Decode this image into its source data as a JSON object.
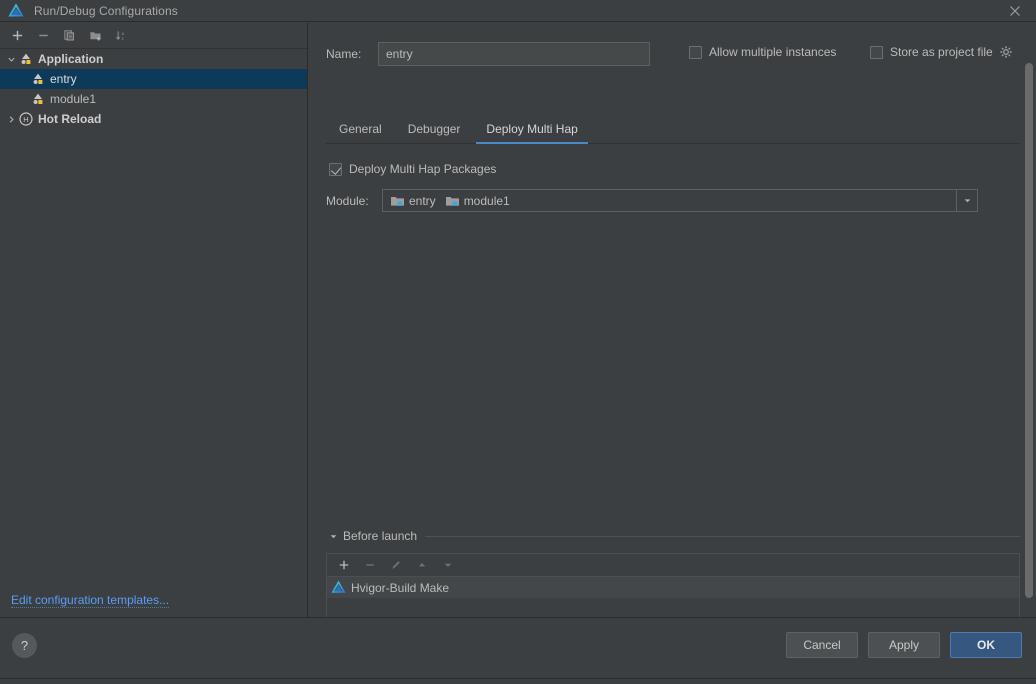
{
  "window": {
    "title": "Run/Debug Configurations",
    "logo_icon": "deveco-studio-logo-icon",
    "close_icon": "close-icon"
  },
  "colors": {
    "background": "#3c3f41",
    "panel_border": "#2b2b2b",
    "text": "#bbbbbb",
    "accent_blue": "#4a88c7",
    "selection": "#0d3a58",
    "link": "#589df6",
    "primary_button": "#365880"
  },
  "sidebar": {
    "toolbar": [
      {
        "name": "add-configuration-button",
        "icon": "plus-icon",
        "label": "+",
        "enabled": true
      },
      {
        "name": "remove-configuration-button",
        "icon": "minus-icon",
        "label": "−",
        "enabled": false
      },
      {
        "name": "copy-configuration-button",
        "icon": "copy-icon",
        "label": "",
        "enabled": false
      },
      {
        "name": "move-into-folder-button",
        "icon": "folder-add-icon",
        "label": "",
        "enabled": false
      },
      {
        "name": "sort-configurations-button",
        "icon": "sort-alphabetically-icon",
        "label": "",
        "enabled": false
      }
    ],
    "tree": [
      {
        "label": "Application",
        "icon": "application-module-icon",
        "expanded": true,
        "level": 0,
        "bold": true,
        "selected": false,
        "has_arrow": true
      },
      {
        "label": "entry",
        "icon": "application-module-icon",
        "level": 1,
        "bold": false,
        "selected": true,
        "has_arrow": false
      },
      {
        "label": "module1",
        "icon": "application-module-icon",
        "level": 1,
        "bold": false,
        "selected": false,
        "has_arrow": false
      },
      {
        "label": "Hot Reload",
        "icon": "hot-reload-icon",
        "expanded": false,
        "level": 0,
        "bold": true,
        "selected": false,
        "has_arrow": true
      }
    ],
    "edit_templates_link": "Edit configuration templates..."
  },
  "main": {
    "name_field": {
      "label": "Name:",
      "value": "entry",
      "placeholder": ""
    },
    "options": [
      {
        "label": "Allow multiple instances",
        "checked": false,
        "name": "allow-multiple-instances-checkbox"
      },
      {
        "label": "Store as project file",
        "checked": false,
        "name": "store-as-project-file-checkbox",
        "gear_icon": "gear-icon"
      }
    ],
    "tabs": [
      {
        "label": "General",
        "active": false
      },
      {
        "label": "Debugger",
        "active": false
      },
      {
        "label": "Deploy Multi Hap",
        "active": true
      }
    ],
    "deploy_multi_hap": {
      "checkbox_label": "Deploy Multi Hap Packages",
      "checkbox_checked": true,
      "module_label": "Module:",
      "module_values": [
        {
          "label": "entry",
          "icon": "module-folder-icon"
        },
        {
          "label": "module1",
          "icon": "module-folder-icon"
        }
      ],
      "dropdown_icon": "chevron-down-icon"
    },
    "before_launch": {
      "title": "Before launch",
      "collapsed": false,
      "caret_icon": "caret-down-icon",
      "toolbar": [
        {
          "name": "add-task-button",
          "icon": "plus-icon",
          "enabled": true
        },
        {
          "name": "remove-task-button",
          "icon": "minus-icon",
          "enabled": false
        },
        {
          "name": "edit-task-button",
          "icon": "pencil-icon",
          "enabled": false
        },
        {
          "name": "move-task-up-button",
          "icon": "arrow-up-icon",
          "enabled": false
        },
        {
          "name": "move-task-down-button",
          "icon": "arrow-down-icon",
          "enabled": false
        }
      ],
      "items": [
        {
          "label": "Hvigor-Build Make",
          "icon": "hvigor-build-icon"
        }
      ]
    }
  },
  "footer": {
    "help_label": "?",
    "buttons": [
      {
        "label": "Cancel",
        "name": "cancel-button",
        "primary": false
      },
      {
        "label": "Apply",
        "name": "apply-button",
        "primary": false
      },
      {
        "label": "OK",
        "name": "ok-button",
        "primary": true
      }
    ]
  }
}
